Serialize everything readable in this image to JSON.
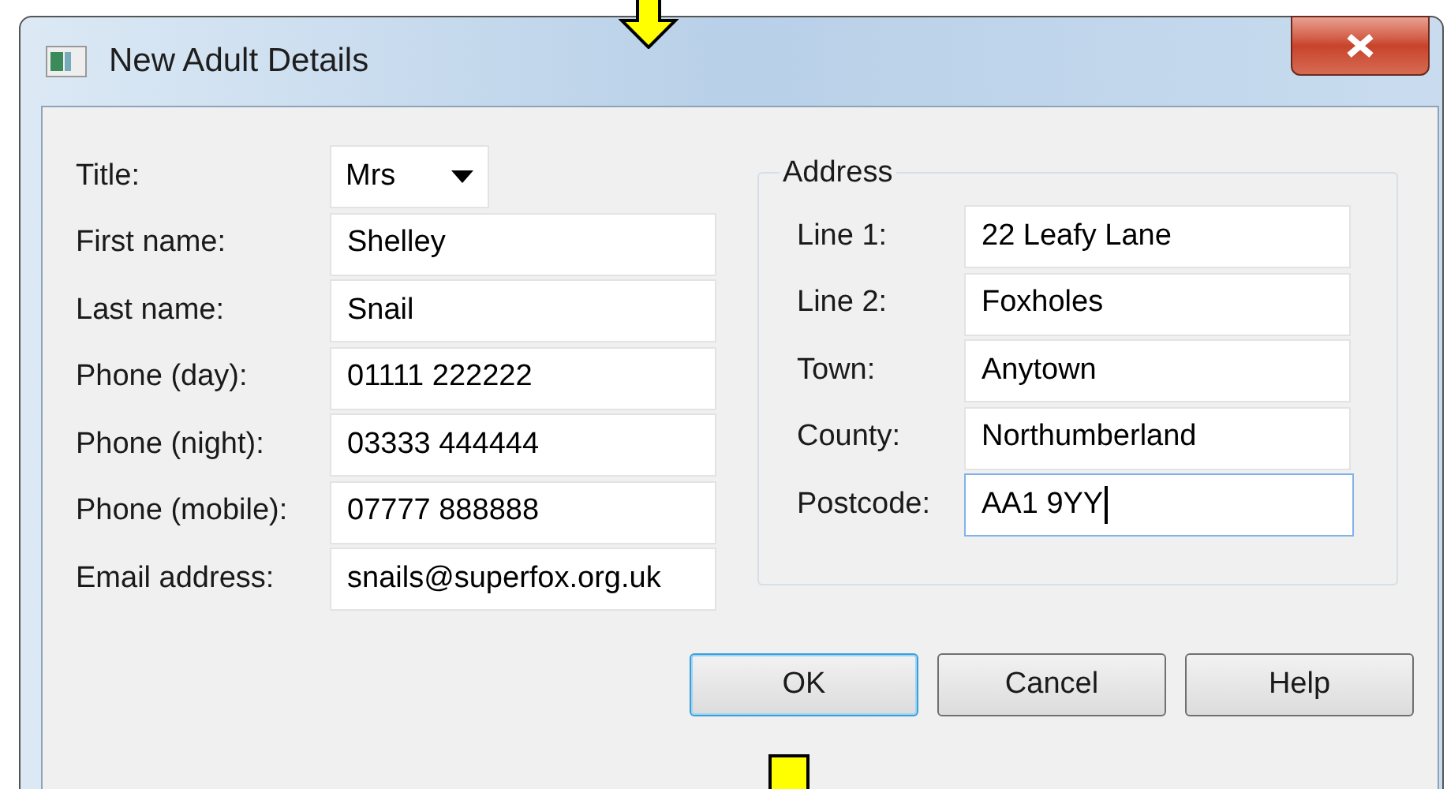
{
  "window": {
    "title": "New Adult Details"
  },
  "title_field": {
    "label": "Title:",
    "value": "Mrs"
  },
  "person_fields": [
    {
      "label": "First name:",
      "value": "Shelley",
      "focused": false
    },
    {
      "label": "Last name:",
      "value": "Snail",
      "focused": false
    },
    {
      "label": "Phone (day):",
      "value": "01111 222222",
      "focused": false
    },
    {
      "label": "Phone (night):",
      "value": "03333 444444",
      "focused": false
    },
    {
      "label": "Phone (mobile):",
      "value": "07777 888888",
      "focused": false
    },
    {
      "label": "Email address:",
      "value": "snails@superfox.org.uk",
      "focused": false
    }
  ],
  "address": {
    "title": "Address",
    "fields": [
      {
        "label": "Line 1:",
        "value": "22 Leafy Lane",
        "focused": false
      },
      {
        "label": "Line 2:",
        "value": "Foxholes",
        "focused": false
      },
      {
        "label": "Town:",
        "value": "Anytown",
        "focused": false
      },
      {
        "label": "County:",
        "value": "Northumberland",
        "focused": false
      },
      {
        "label": "Postcode:",
        "value": "AA1 9YY",
        "focused": true
      }
    ]
  },
  "buttons": [
    {
      "label": "OK",
      "default": true
    },
    {
      "label": "Cancel",
      "default": false
    },
    {
      "label": "Help",
      "default": false
    }
  ]
}
